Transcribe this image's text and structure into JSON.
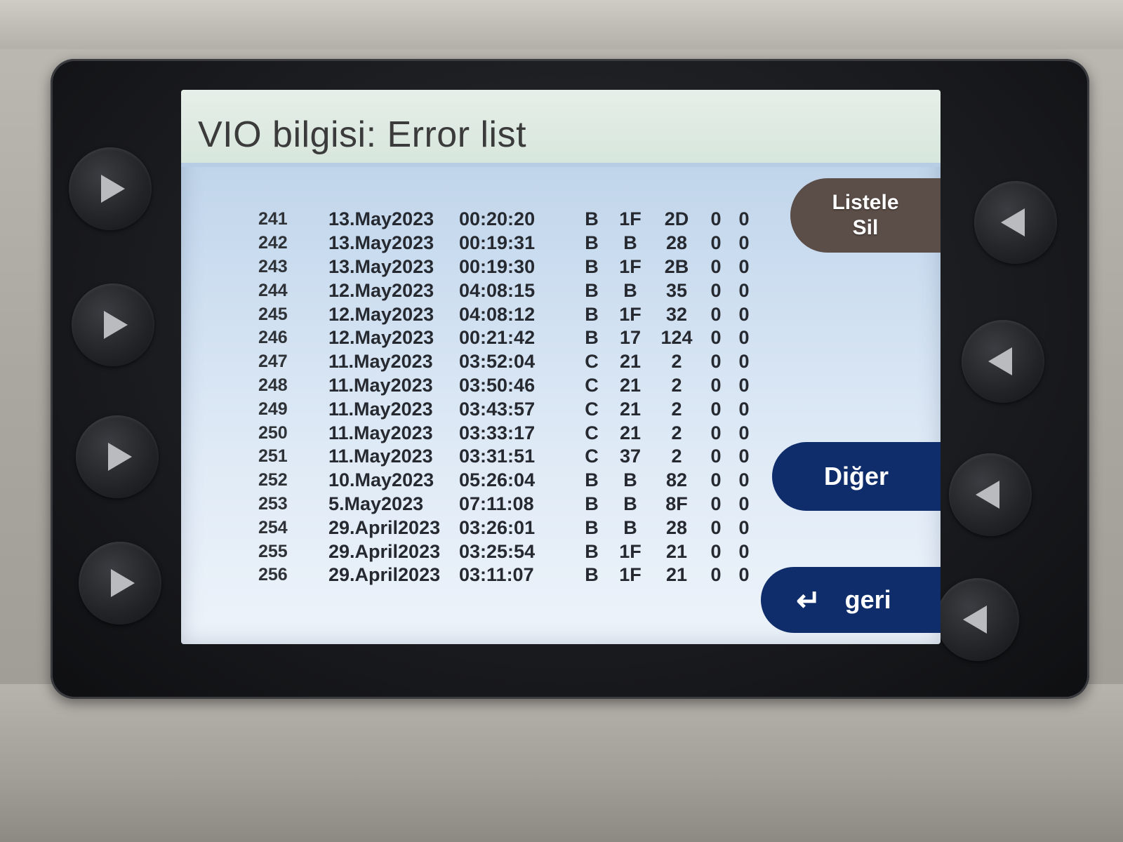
{
  "screen": {
    "title": "VIO bilgisi: Error list"
  },
  "soft_buttons": {
    "listele_line1": "Listele",
    "listele_line2": "Sil",
    "diger": "Diğer",
    "geri": "geri",
    "geri_icon": "return-arrow-icon"
  },
  "error_list": {
    "rows": [
      {
        "idx": "241",
        "date": "13.May2023",
        "time": "00:20:20",
        "a": "B",
        "b": "1F",
        "c": "2D",
        "d": "0",
        "e": "0"
      },
      {
        "idx": "242",
        "date": "13.May2023",
        "time": "00:19:31",
        "a": "B",
        "b": "B",
        "c": "28",
        "d": "0",
        "e": "0"
      },
      {
        "idx": "243",
        "date": "13.May2023",
        "time": "00:19:30",
        "a": "B",
        "b": "1F",
        "c": "2B",
        "d": "0",
        "e": "0"
      },
      {
        "idx": "244",
        "date": "12.May2023",
        "time": "04:08:15",
        "a": "B",
        "b": "B",
        "c": "35",
        "d": "0",
        "e": "0"
      },
      {
        "idx": "245",
        "date": "12.May2023",
        "time": "04:08:12",
        "a": "B",
        "b": "1F",
        "c": "32",
        "d": "0",
        "e": "0"
      },
      {
        "idx": "246",
        "date": "12.May2023",
        "time": "00:21:42",
        "a": "B",
        "b": "17",
        "c": "124",
        "d": "0",
        "e": "0"
      },
      {
        "idx": "247",
        "date": "11.May2023",
        "time": "03:52:04",
        "a": "C",
        "b": "21",
        "c": "2",
        "d": "0",
        "e": "0"
      },
      {
        "idx": "248",
        "date": "11.May2023",
        "time": "03:50:46",
        "a": "C",
        "b": "21",
        "c": "2",
        "d": "0",
        "e": "0"
      },
      {
        "idx": "249",
        "date": "11.May2023",
        "time": "03:43:57",
        "a": "C",
        "b": "21",
        "c": "2",
        "d": "0",
        "e": "0"
      },
      {
        "idx": "250",
        "date": "11.May2023",
        "time": "03:33:17",
        "a": "C",
        "b": "21",
        "c": "2",
        "d": "0",
        "e": "0"
      },
      {
        "idx": "251",
        "date": "11.May2023",
        "time": "03:31:51",
        "a": "C",
        "b": "37",
        "c": "2",
        "d": "0",
        "e": "0"
      },
      {
        "idx": "252",
        "date": "10.May2023",
        "time": "05:26:04",
        "a": "B",
        "b": "B",
        "c": "82",
        "d": "0",
        "e": "0"
      },
      {
        "idx": "253",
        "date": "5.May2023",
        "time": "07:11:08",
        "a": "B",
        "b": "B",
        "c": "8F",
        "d": "0",
        "e": "0"
      },
      {
        "idx": "254",
        "date": "29.April2023",
        "time": "03:26:01",
        "a": "B",
        "b": "B",
        "c": "28",
        "d": "0",
        "e": "0"
      },
      {
        "idx": "255",
        "date": "29.April2023",
        "time": "03:25:54",
        "a": "B",
        "b": "1F",
        "c": "21",
        "d": "0",
        "e": "0"
      },
      {
        "idx": "256",
        "date": "29.April2023",
        "time": "03:11:07",
        "a": "B",
        "b": "1F",
        "c": "21",
        "d": "0",
        "e": "0"
      }
    ]
  },
  "hardware_buttons": {
    "left": [
      "play-right-icon",
      "play-right-icon",
      "play-right-icon",
      "play-right-icon"
    ],
    "right": [
      "play-left-icon",
      "play-left-icon",
      "play-left-icon",
      "play-left-icon"
    ]
  },
  "colors": {
    "title_bar": "#d7e6dc",
    "listele_button": "#5b4d47",
    "nav_buttons": "#0f2d6b",
    "text": "#262a30"
  }
}
